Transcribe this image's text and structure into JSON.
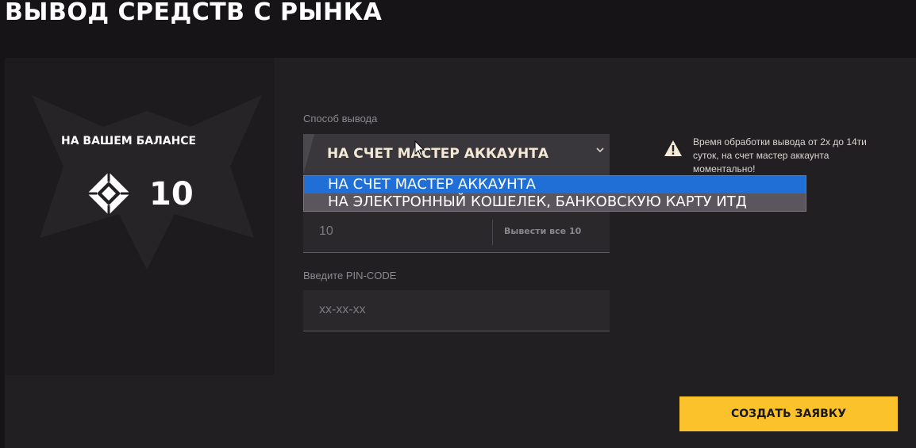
{
  "header": {
    "title": "ВЫВОД СРЕДСТВ С РЫНКА"
  },
  "balance": {
    "label": "НА ВАШЕМ БАЛАНСЕ",
    "amount": "10",
    "icon": "crystal-coin-icon"
  },
  "withdraw_method": {
    "label": "Способ вывода",
    "selected": "НА СЧЕТ МАСТЕР АККАУНТА",
    "options": [
      "НА СЧЕТ МАСТЕР АККАУНТА",
      "НА ЭЛЕКТРОННЫЙ КОШЕЛЕК, БАНКОВСКУЮ КАРТУ ИТД"
    ]
  },
  "amount_field": {
    "value": "10",
    "withdraw_all_label": "Вывести все 10"
  },
  "pin": {
    "label": "Введите PIN-CODE",
    "placeholder": "xx-xx-xx"
  },
  "notice": {
    "text": "Время обработки вывода от 2х до 14ти суток, на счет мастер аккаунта моментально!",
    "icon": "warning-icon"
  },
  "actions": {
    "submit_label": "СОЗДАТЬ ЗАЯВКУ"
  },
  "colors": {
    "accent": "#fbc22c",
    "selected_option": "#1f6fd6",
    "panel": "#211f22"
  }
}
